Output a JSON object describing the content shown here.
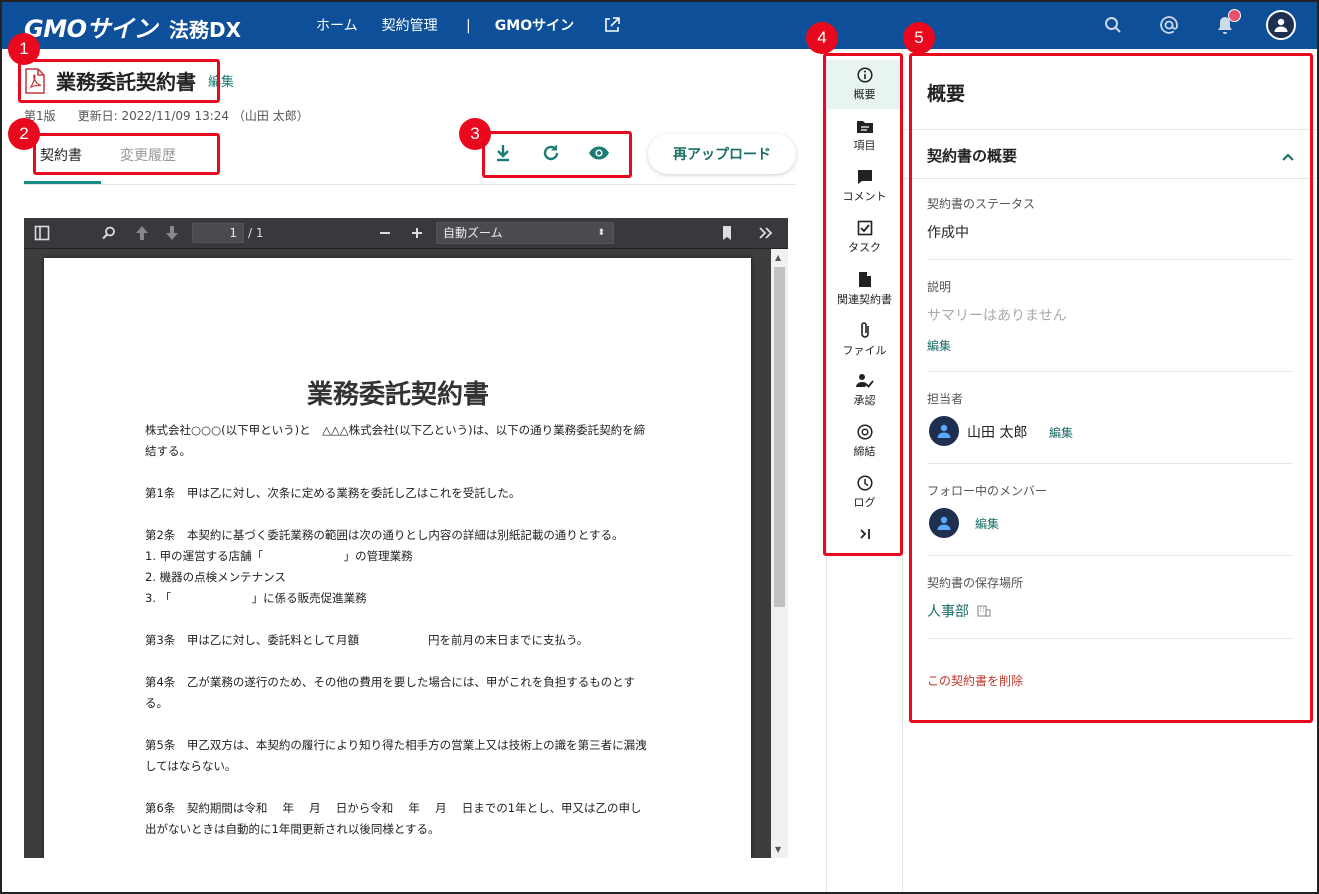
{
  "header": {
    "brand": "GMOサイン",
    "product": "法務DX",
    "nav": [
      "ホーム",
      "契約管理",
      "GMOサイン"
    ]
  },
  "document": {
    "title": "業務委託契約書",
    "edit_label": "編集",
    "version": "第1版",
    "updated": "更新日: 2022/11/09 13:24 （山田 太郎）"
  },
  "tabs": [
    "契約書",
    "変更履歴"
  ],
  "actions": {
    "reupload_label": "再アップロード"
  },
  "pdf_viewer": {
    "page_current": "1",
    "page_total": "/ 1",
    "zoom": "自動ズーム"
  },
  "pdf_content": {
    "heading": "業務委託契約書",
    "intro": "株式会社○○○(以下甲という)と　△△△株式会社(以下乙という)は、以下の通り業務委託契約を締結する。",
    "art1": "第1条　甲は乙に対し、次条に定める業務を委託し乙はこれを受託した。",
    "art2": "第2条　本契約に基づく委託業務の範囲は次の通りとし内容の詳細は別紙記載の通りとする。",
    "art2_items": [
      "1. 甲の運営する店舗「　　　　　　　」の管理業務",
      "2. 機器の点検メンテナンス",
      "3. 「　　　　　　　」に係る販売促進業務"
    ],
    "art3": "第3条　甲は乙に対し、委託料として月額　　　　　　円を前月の末日までに支払う。",
    "art4": "第4条　乙が業務の遂行のため、その他の費用を要した場合には、甲がこれを負担するものとする。",
    "art5": "第5条　甲乙双方は、本契約の履行により知り得た相手方の営業上又は技術上の識を第三者に漏洩してはならない。",
    "art6": "第6条　契約期間は令和　 年　 月　 日から令和　 年　 月　 日までの1年とし、甲又は乙の申し出がないときは自動的に1年間更新され以後同様とする。"
  },
  "side_menu": [
    "概要",
    "項目",
    "コメント",
    "タスク",
    "関連契約書",
    "ファイル",
    "承認",
    "締結",
    "ログ"
  ],
  "panel": {
    "title": "概要",
    "section_title": "契約書の概要",
    "status_label": "契約書のステータス",
    "status_value": "作成中",
    "desc_label": "説明",
    "desc_placeholder": "サマリーはありません",
    "desc_edit": "編集",
    "owner_label": "担当者",
    "owner_name": "山田 太郎",
    "owner_edit": "編集",
    "followers_label": "フォロー中のメンバー",
    "followers_edit": "編集",
    "location_label": "契約書の保存場所",
    "location_value": "人事部",
    "delete_label": "この契約書を削除"
  },
  "annotations": [
    "1",
    "2",
    "3",
    "4",
    "5"
  ],
  "colors": {
    "header_bg": "#0d4f99",
    "accent": "#1a8c84",
    "annotation": "#e8091e",
    "delete": "#c0392b"
  }
}
